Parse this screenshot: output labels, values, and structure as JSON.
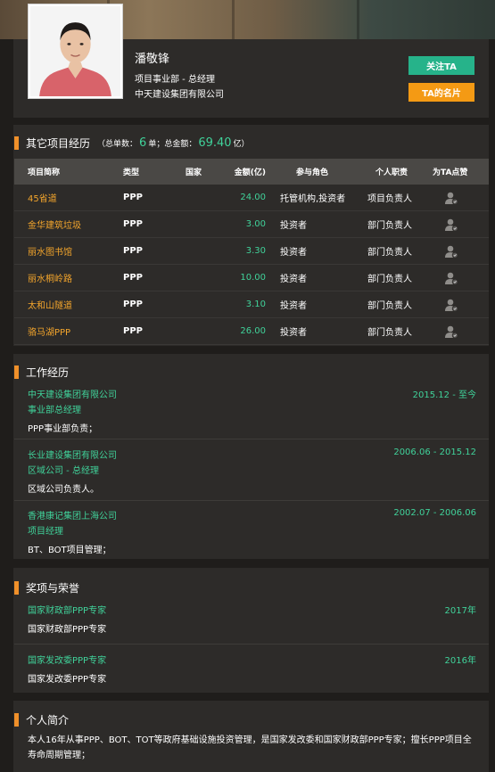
{
  "profile": {
    "name": "潘敬锋",
    "title": "项目事业部 - 总经理",
    "company": "中天建设集团有限公司",
    "follow_label": "关注TA",
    "card_label": "TA的名片"
  },
  "projects": {
    "heading": "其它项目经历",
    "summary_prefix": "（总单数：",
    "count": "6",
    "summary_mid": "单；总金额：",
    "total": "69.40",
    "summary_suffix": "亿）",
    "columns": [
      "项目简称",
      "类型",
      "国家",
      "金额(亿)",
      "参与角色",
      "个人职责",
      "为TA点赞"
    ],
    "rows": [
      {
        "name": "45省道",
        "type": "PPP",
        "country": "",
        "amount": "24.00",
        "role": "托管机构,投资者",
        "duty": "项目负责人"
      },
      {
        "name": "金华建筑垃圾",
        "type": "PPP",
        "country": "",
        "amount": "3.00",
        "role": "投资者",
        "duty": "部门负责人"
      },
      {
        "name": "丽水图书馆",
        "type": "PPP",
        "country": "",
        "amount": "3.30",
        "role": "投资者",
        "duty": "部门负责人"
      },
      {
        "name": "丽水桐岭路",
        "type": "PPP",
        "country": "",
        "amount": "10.00",
        "role": "投资者",
        "duty": "部门负责人"
      },
      {
        "name": "太和山隧道",
        "type": "PPP",
        "country": "",
        "amount": "3.10",
        "role": "投资者",
        "duty": "部门负责人"
      },
      {
        "name": "骆马湖PPP",
        "type": "PPP",
        "country": "",
        "amount": "26.00",
        "role": "投资者",
        "duty": "部门负责人"
      }
    ]
  },
  "work": {
    "heading": "工作经历",
    "items": [
      {
        "company": "中天建设集团有限公司",
        "position": "事业部总经理",
        "date": "2015.12  -  至今",
        "desc": "PPP事业部负责；"
      },
      {
        "company": "长业建设集团有限公司",
        "position": "区域公司 - 总经理",
        "date": "2006.06  -  2015.12",
        "desc": "区域公司负责人。"
      },
      {
        "company": "香港康记集团上海公司",
        "position": "项目经理",
        "date": "2002.07  -  2006.06",
        "desc": "BT、BOT项目管理；"
      }
    ]
  },
  "awards": {
    "heading": "奖项与荣誉",
    "items": [
      {
        "title": "国家财政部PPP专家",
        "year": "2017年",
        "desc": "国家财政部PPP专家"
      },
      {
        "title": "国家发改委PPP专家",
        "year": "2016年",
        "desc": "国家发改委PPP专家"
      }
    ]
  },
  "bio": {
    "heading": "个人简介",
    "text": "本人16年从事PPP、BOT、TOT等政府基础设施投资管理，是国家发改委和国家财政部PPP专家；擅长PPP项目全寿命周期管理；"
  },
  "colors": {
    "accent_green": "#26b38a",
    "accent_orange": "#f49a14",
    "link_orange": "#f3a52c",
    "value_green": "#40d29a",
    "section_bar": "#f0902a"
  }
}
